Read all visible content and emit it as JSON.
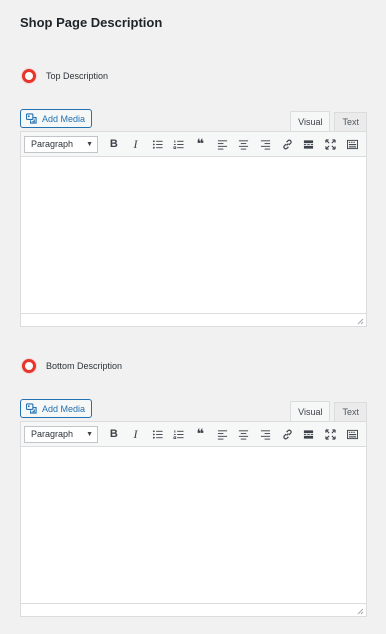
{
  "page": {
    "title": "Shop Page Description"
  },
  "editor_common": {
    "add_media_label": "Add Media",
    "tab_visual": "Visual",
    "tab_text": "Text",
    "format_value": "Paragraph"
  },
  "sections": [
    {
      "label": "Top Description"
    },
    {
      "label": "Bottom Description"
    }
  ],
  "colors": {
    "radio_accent": "#e8352b",
    "link_blue": "#2271b1"
  },
  "toolbar_icons": [
    "bold-icon",
    "italic-icon",
    "bullet-list-icon",
    "numbered-list-icon",
    "blockquote-icon",
    "align-left-icon",
    "align-center-icon",
    "align-right-icon",
    "link-icon",
    "read-more-icon",
    "fullscreen-icon",
    "toolbar-toggle-icon"
  ]
}
